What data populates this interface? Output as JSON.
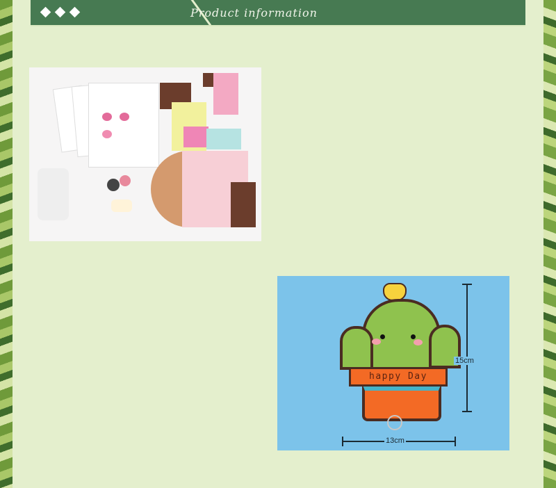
{
  "header": {
    "title": "Product information",
    "bullets": [
      "diamond",
      "diamond",
      "diamond"
    ]
  },
  "kit_photo": {
    "name": "felt-kit-contents"
  },
  "product_photo": {
    "pot_text": "happy Day",
    "height_label": "15cm",
    "width_label": "13cm"
  },
  "colors": {
    "accent": "#477a52",
    "background": "#e4efcd",
    "photo_bg": "#7cc3ea"
  }
}
